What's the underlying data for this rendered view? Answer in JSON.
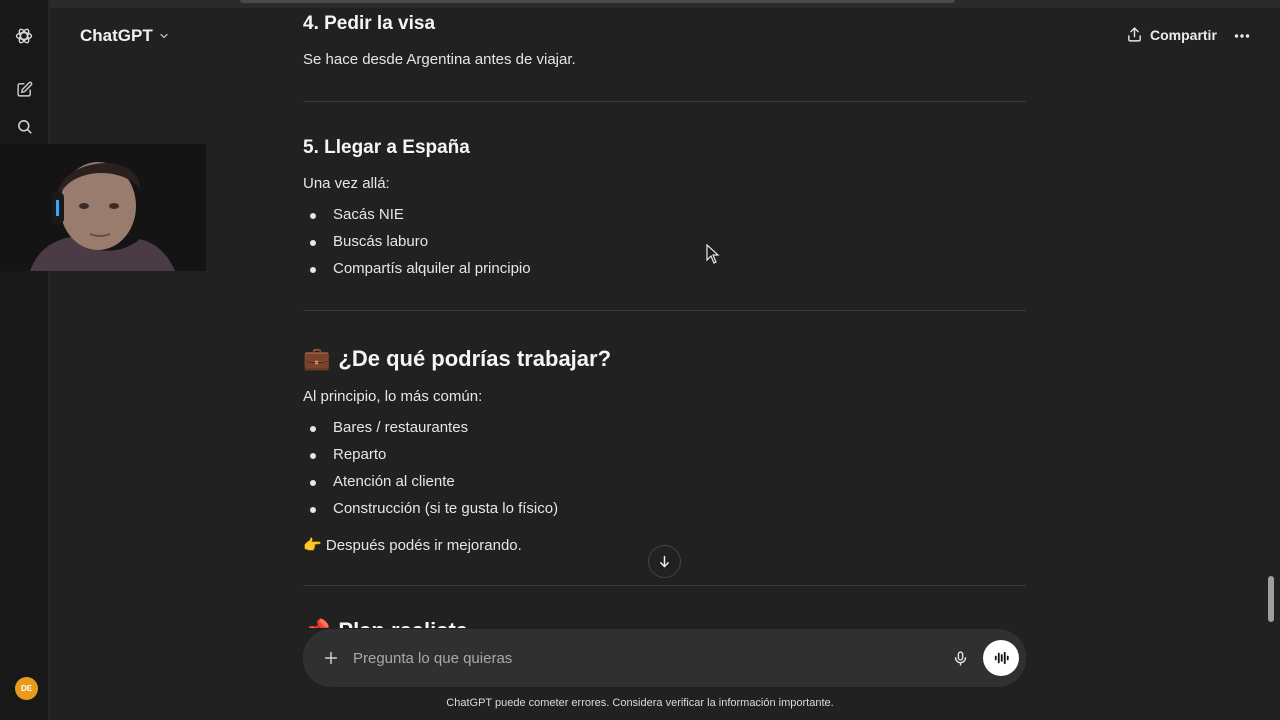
{
  "header": {
    "model_name": "ChatGPT",
    "share_label": "Compartir"
  },
  "sidebar": {
    "avatar_initials": "DE"
  },
  "content": {
    "step4_title": "4. Pedir la visa",
    "step4_text": "Se hace desde Argentina antes de viajar.",
    "step5_title": "5. Llegar a España",
    "step5_intro": "Una vez allá:",
    "step5_items": [
      "Sacás NIE",
      "Buscás laburo",
      "Compartís alquiler al principio"
    ],
    "work_emoji": "💼",
    "work_title": "¿De qué podrías trabajar?",
    "work_intro": "Al principio, lo más común:",
    "work_items": [
      "Bares / restaurantes",
      "Reparto",
      "Atención al cliente",
      "Construcción (si te gusta lo físico)"
    ],
    "note_emoji": "👉",
    "note_text": "Después podés ir mejorando.",
    "next_emoji": "📌",
    "next_partial": "Plan realista"
  },
  "composer": {
    "placeholder": "Pregunta lo que quieras"
  },
  "footer": {
    "disclaimer": "ChatGPT puede cometer errores. Considera verificar la información importante."
  }
}
